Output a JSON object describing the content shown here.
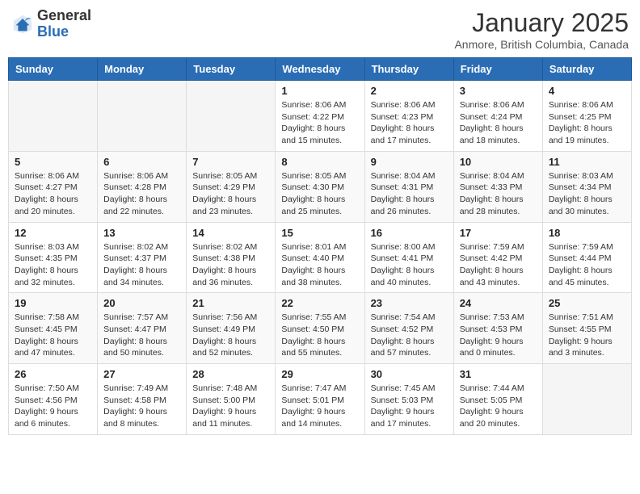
{
  "header": {
    "logo_general": "General",
    "logo_blue": "Blue",
    "main_title": "January 2025",
    "subtitle": "Anmore, British Columbia, Canada"
  },
  "calendar": {
    "weekdays": [
      "Sunday",
      "Monday",
      "Tuesday",
      "Wednesday",
      "Thursday",
      "Friday",
      "Saturday"
    ],
    "weeks": [
      [
        {
          "day": "",
          "info": ""
        },
        {
          "day": "",
          "info": ""
        },
        {
          "day": "",
          "info": ""
        },
        {
          "day": "1",
          "info": "Sunrise: 8:06 AM\nSunset: 4:22 PM\nDaylight: 8 hours\nand 15 minutes."
        },
        {
          "day": "2",
          "info": "Sunrise: 8:06 AM\nSunset: 4:23 PM\nDaylight: 8 hours\nand 17 minutes."
        },
        {
          "day": "3",
          "info": "Sunrise: 8:06 AM\nSunset: 4:24 PM\nDaylight: 8 hours\nand 18 minutes."
        },
        {
          "day": "4",
          "info": "Sunrise: 8:06 AM\nSunset: 4:25 PM\nDaylight: 8 hours\nand 19 minutes."
        }
      ],
      [
        {
          "day": "5",
          "info": "Sunrise: 8:06 AM\nSunset: 4:27 PM\nDaylight: 8 hours\nand 20 minutes."
        },
        {
          "day": "6",
          "info": "Sunrise: 8:06 AM\nSunset: 4:28 PM\nDaylight: 8 hours\nand 22 minutes."
        },
        {
          "day": "7",
          "info": "Sunrise: 8:05 AM\nSunset: 4:29 PM\nDaylight: 8 hours\nand 23 minutes."
        },
        {
          "day": "8",
          "info": "Sunrise: 8:05 AM\nSunset: 4:30 PM\nDaylight: 8 hours\nand 25 minutes."
        },
        {
          "day": "9",
          "info": "Sunrise: 8:04 AM\nSunset: 4:31 PM\nDaylight: 8 hours\nand 26 minutes."
        },
        {
          "day": "10",
          "info": "Sunrise: 8:04 AM\nSunset: 4:33 PM\nDaylight: 8 hours\nand 28 minutes."
        },
        {
          "day": "11",
          "info": "Sunrise: 8:03 AM\nSunset: 4:34 PM\nDaylight: 8 hours\nand 30 minutes."
        }
      ],
      [
        {
          "day": "12",
          "info": "Sunrise: 8:03 AM\nSunset: 4:35 PM\nDaylight: 8 hours\nand 32 minutes."
        },
        {
          "day": "13",
          "info": "Sunrise: 8:02 AM\nSunset: 4:37 PM\nDaylight: 8 hours\nand 34 minutes."
        },
        {
          "day": "14",
          "info": "Sunrise: 8:02 AM\nSunset: 4:38 PM\nDaylight: 8 hours\nand 36 minutes."
        },
        {
          "day": "15",
          "info": "Sunrise: 8:01 AM\nSunset: 4:40 PM\nDaylight: 8 hours\nand 38 minutes."
        },
        {
          "day": "16",
          "info": "Sunrise: 8:00 AM\nSunset: 4:41 PM\nDaylight: 8 hours\nand 40 minutes."
        },
        {
          "day": "17",
          "info": "Sunrise: 7:59 AM\nSunset: 4:42 PM\nDaylight: 8 hours\nand 43 minutes."
        },
        {
          "day": "18",
          "info": "Sunrise: 7:59 AM\nSunset: 4:44 PM\nDaylight: 8 hours\nand 45 minutes."
        }
      ],
      [
        {
          "day": "19",
          "info": "Sunrise: 7:58 AM\nSunset: 4:45 PM\nDaylight: 8 hours\nand 47 minutes."
        },
        {
          "day": "20",
          "info": "Sunrise: 7:57 AM\nSunset: 4:47 PM\nDaylight: 8 hours\nand 50 minutes."
        },
        {
          "day": "21",
          "info": "Sunrise: 7:56 AM\nSunset: 4:49 PM\nDaylight: 8 hours\nand 52 minutes."
        },
        {
          "day": "22",
          "info": "Sunrise: 7:55 AM\nSunset: 4:50 PM\nDaylight: 8 hours\nand 55 minutes."
        },
        {
          "day": "23",
          "info": "Sunrise: 7:54 AM\nSunset: 4:52 PM\nDaylight: 8 hours\nand 57 minutes."
        },
        {
          "day": "24",
          "info": "Sunrise: 7:53 AM\nSunset: 4:53 PM\nDaylight: 9 hours\nand 0 minutes."
        },
        {
          "day": "25",
          "info": "Sunrise: 7:51 AM\nSunset: 4:55 PM\nDaylight: 9 hours\nand 3 minutes."
        }
      ],
      [
        {
          "day": "26",
          "info": "Sunrise: 7:50 AM\nSunset: 4:56 PM\nDaylight: 9 hours\nand 6 minutes."
        },
        {
          "day": "27",
          "info": "Sunrise: 7:49 AM\nSunset: 4:58 PM\nDaylight: 9 hours\nand 8 minutes."
        },
        {
          "day": "28",
          "info": "Sunrise: 7:48 AM\nSunset: 5:00 PM\nDaylight: 9 hours\nand 11 minutes."
        },
        {
          "day": "29",
          "info": "Sunrise: 7:47 AM\nSunset: 5:01 PM\nDaylight: 9 hours\nand 14 minutes."
        },
        {
          "day": "30",
          "info": "Sunrise: 7:45 AM\nSunset: 5:03 PM\nDaylight: 9 hours\nand 17 minutes."
        },
        {
          "day": "31",
          "info": "Sunrise: 7:44 AM\nSunset: 5:05 PM\nDaylight: 9 hours\nand 20 minutes."
        },
        {
          "day": "",
          "info": ""
        }
      ]
    ]
  }
}
